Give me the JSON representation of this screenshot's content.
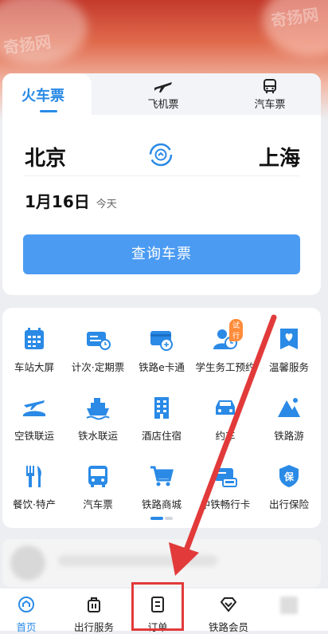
{
  "hero": {
    "watermarks": [
      "奇扬网",
      "奇扬网"
    ]
  },
  "tabs": [
    {
      "label": "火车票",
      "icon": "train-icon",
      "active": true
    },
    {
      "label": "飞机票",
      "icon": "plane-icon",
      "active": false
    },
    {
      "label": "汽车票",
      "icon": "bus-icon",
      "active": false
    }
  ],
  "route": {
    "from": "北京",
    "to": "上海"
  },
  "date": {
    "value": "1月16日",
    "note": "今天"
  },
  "search_label": "查询车票",
  "services": [
    {
      "label": "车站大屏",
      "icon": "station-screen-icon"
    },
    {
      "label": "计次·定期票",
      "icon": "ticket-card-icon"
    },
    {
      "label": "铁路e卡通",
      "icon": "railcard-icon"
    },
    {
      "label": "学生务工预约",
      "icon": "student-icon",
      "badge": "试行"
    },
    {
      "label": "温馨服务",
      "icon": "heart-service-icon"
    },
    {
      "label": "空铁联运",
      "icon": "air-rail-icon"
    },
    {
      "label": "铁水联运",
      "icon": "ship-icon"
    },
    {
      "label": "酒店住宿",
      "icon": "hotel-icon"
    },
    {
      "label": "约车",
      "icon": "car-icon"
    },
    {
      "label": "铁路游",
      "icon": "mountain-icon"
    },
    {
      "label": "餐饮·特产",
      "icon": "food-icon"
    },
    {
      "label": "汽车票",
      "icon": "bus-icon"
    },
    {
      "label": "铁路商城",
      "icon": "cart-icon"
    },
    {
      "label": "中铁畅行卡",
      "icon": "train-card-icon"
    },
    {
      "label": "出行保险",
      "icon": "insurance-icon"
    }
  ],
  "bottom_nav": [
    {
      "label": "首页",
      "icon": "home-icon",
      "active": true
    },
    {
      "label": "出行服务",
      "icon": "luggage-icon",
      "active": false
    },
    {
      "label": "订单",
      "icon": "order-icon",
      "active": false
    },
    {
      "label": "铁路会员",
      "icon": "diamond-icon",
      "active": false
    }
  ],
  "colors": {
    "accent": "#2a8ae6",
    "button": "#4b9bf2",
    "annotation": "#e23a3a"
  }
}
